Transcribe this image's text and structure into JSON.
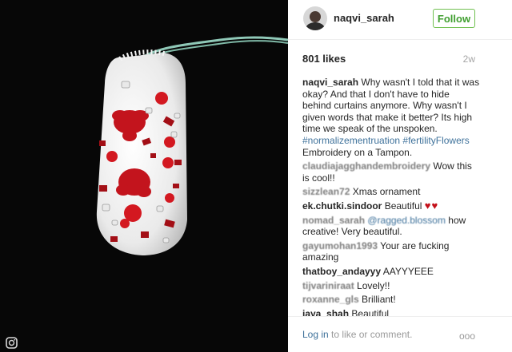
{
  "photo": {
    "icon": "instagram-icon"
  },
  "post": {
    "username": "naqvi_sarah",
    "follow_label": "Follow",
    "likes": "801 likes",
    "time": "2w"
  },
  "caption": {
    "username": "naqvi_sarah",
    "text": "Why wasn't I told that it was okay? And that I don't have to hide behind curtains anymore. Why wasn't I given words that make it better? Its high time we speak of the unspoken.",
    "tag1": "#normalizementruation",
    "tag2": "#fertilityFlowers",
    "text2": "Embroidery on a Tampon."
  },
  "comments": [
    {
      "username": "claudiajagghandembroidery",
      "text": "Wow this is cool!!"
    },
    {
      "username": "sizzlean72",
      "text": "Xmas ornament"
    },
    {
      "username": "ek.chutki.sindoor",
      "text": "Beautiful",
      "hearts": "♥♥"
    },
    {
      "username": "nomad_sarah",
      "mention": "@ragged.blossom",
      "text": "how creative! Very beautiful."
    },
    {
      "username": "gayumohan1993",
      "text": "Your are fucking amazing"
    },
    {
      "username": "thatboy_andayyy",
      "text": "AAYYYEEE"
    },
    {
      "username": "tijvariniraat",
      "text": "Lovely!!"
    },
    {
      "username": "roxanne_gls",
      "text": "Brilliant!"
    },
    {
      "username": "jaya_shah",
      "text": "Beautiful"
    }
  ],
  "footer": {
    "login": "Log in",
    "rest": " to like or comment.",
    "more": "ooo"
  }
}
